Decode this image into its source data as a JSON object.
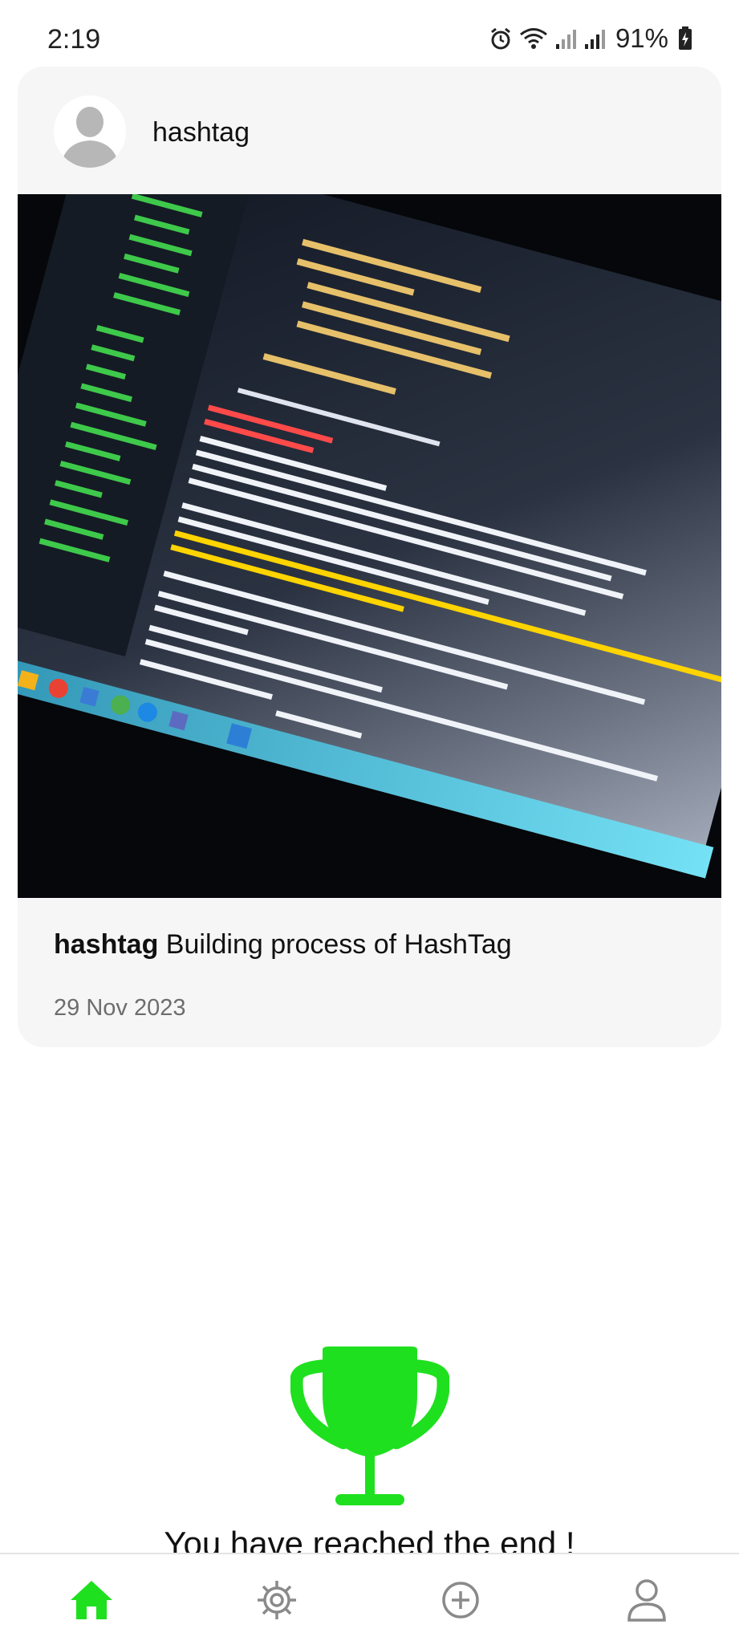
{
  "status_bar": {
    "time": "2:19",
    "battery": "91%"
  },
  "post": {
    "username": "hashtag",
    "image_description": "photo of a VS Code window showing an EAS build in the terminal",
    "caption_user": "hashtag",
    "caption_text": " Building process of HashTag",
    "date": "29 Nov 2023"
  },
  "end_message": "You have reached the end !",
  "nav": {
    "items": [
      "home-icon",
      "settings-icon",
      "add-post-icon",
      "profile-icon"
    ],
    "active": "home"
  },
  "colors": {
    "accent": "#1fe01f",
    "card_bg": "#f6f6f6",
    "icon_inactive": "#8a8a8a"
  }
}
